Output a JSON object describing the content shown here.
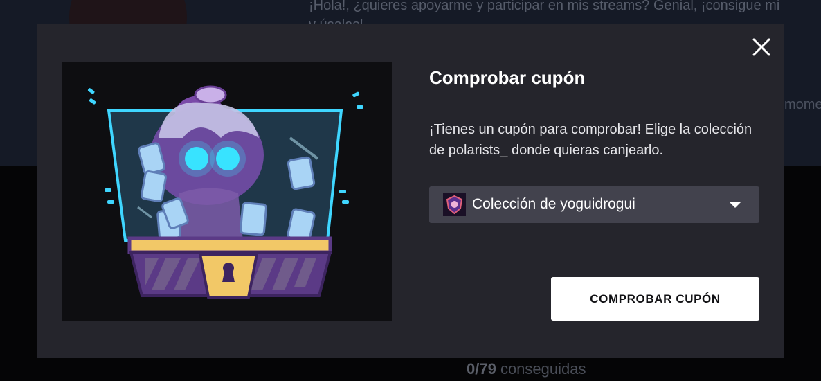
{
  "background": {
    "intro_line_1": "¡Hola!, ¿quieres apoyarme y participar en mis streams? Genial, ¡consigue mi",
    "intro_line_2": "y úsalas!",
    "side_text": "momen",
    "progress_count": "0/79",
    "progress_label": " conseguidas"
  },
  "modal": {
    "close_icon": "close-icon",
    "title": "Comprobar cupón",
    "description": "¡Tienes un cupón para comprobar! Elige la colección de polarists_ donde quieras canjearlo.",
    "collection_select": {
      "selected_value": "Colección de yoguidrogui",
      "icon": "collection-badge-icon",
      "arrow_icon": "chevron-down-icon"
    },
    "submit_label": "COMPROBAR CUPÓN",
    "illustration": "treasure-chest-illustration"
  },
  "colors": {
    "modal_bg": "#25252c",
    "select_bg": "#42424d",
    "button_bg": "#ffffff",
    "accent_cyan": "#3fd6ff",
    "chest_purple": "#5b3a86",
    "chest_gold": "#f2c867"
  }
}
